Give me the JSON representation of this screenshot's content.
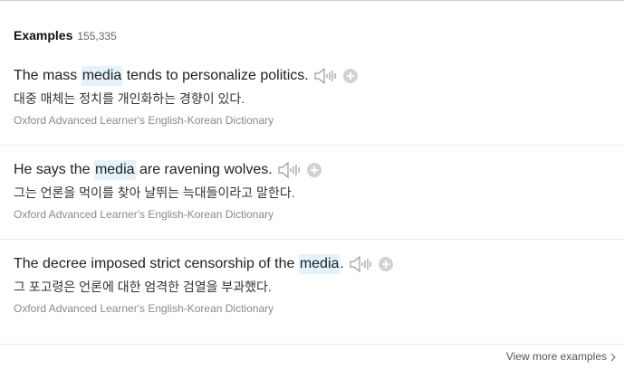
{
  "header": {
    "title": "Examples",
    "count": "155,335"
  },
  "examples": [
    {
      "before": "The mass ",
      "highlight": "media",
      "after": " tends to personalize politics.",
      "translation": "대중 매체는 정치를 개인화하는 경향이 있다.",
      "source": "Oxford Advanced Learner's English-Korean Dictionary"
    },
    {
      "before": "He says the ",
      "highlight": "media",
      "after": " are ravening wolves.",
      "translation": "그는 언론을 먹이를 찾아 날뛰는 늑대들이라고 말한다.",
      "source": "Oxford Advanced Learner's English-Korean Dictionary"
    },
    {
      "before": "The decree imposed strict censorship of the ",
      "highlight": "media",
      "after": ".",
      "translation": "그 포고령은 언론에 대한 엄격한 검열을 부과했다.",
      "source": "Oxford Advanced Learner's English-Korean Dictionary"
    }
  ],
  "footer": {
    "view_more": "View more examples"
  },
  "icons": {
    "speaker": "speaker-icon",
    "add": "plus-circle-icon",
    "chevron": "chevron-right-icon"
  },
  "colors": {
    "highlight_bg": "#e3f2fb",
    "icon_gray": "#9a9a9a",
    "add_circle": "#d2d2d2"
  }
}
